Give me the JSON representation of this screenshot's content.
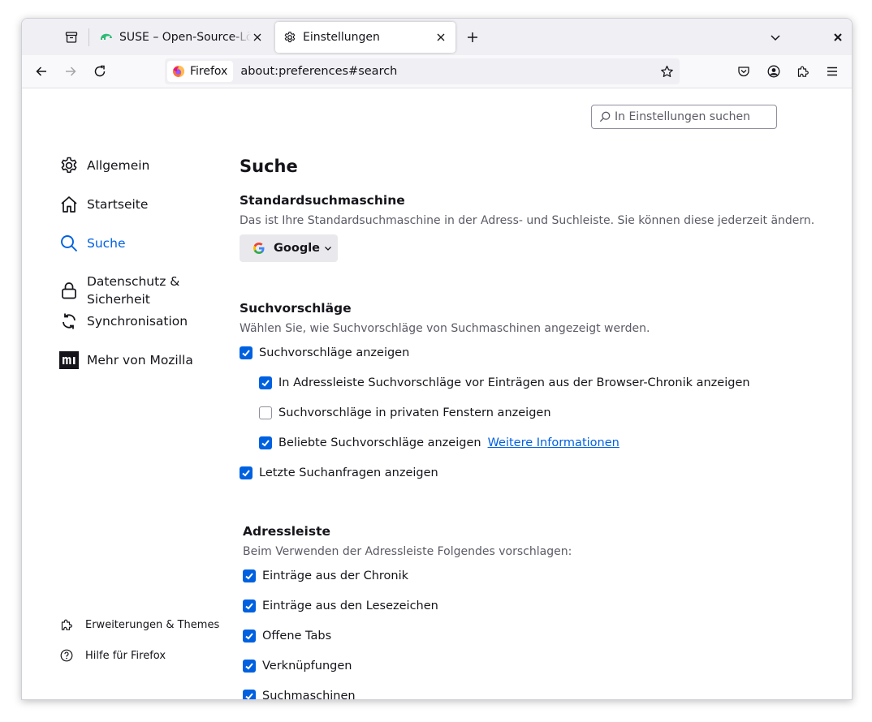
{
  "tabs": [
    {
      "title": "SUSE – Open-Source-Lösungen",
      "active": false,
      "favicon": "suse-chameleon-icon"
    },
    {
      "title": "Einstellungen",
      "active": true,
      "favicon": "gear-icon"
    }
  ],
  "urlbar": {
    "identity_label": "Firefox",
    "url": "about:preferences#search"
  },
  "search_field": {
    "placeholder": "In Einstellungen suchen"
  },
  "sidebar": {
    "items": [
      {
        "label": "Allgemein",
        "icon": "gear-icon"
      },
      {
        "label": "Startseite",
        "icon": "home-icon"
      },
      {
        "label": "Suche",
        "icon": "search-icon",
        "selected": true
      },
      {
        "label": "Datenschutz & Sicherheit",
        "icon": "lock-icon"
      },
      {
        "label": "Synchronisation",
        "icon": "sync-icon"
      },
      {
        "label": "Mehr von Mozilla",
        "icon": "mozilla-icon"
      }
    ],
    "bottom": [
      {
        "label": "Erweiterungen & Themes",
        "icon": "puzzle-icon"
      },
      {
        "label": "Hilfe für Firefox",
        "icon": "help-icon"
      }
    ]
  },
  "main": {
    "title": "Suche",
    "default_engine": {
      "heading": "Standardsuchmaschine",
      "description": "Das ist Ihre Standardsuchmaschine in der Adress- und Suchleiste. Sie können diese jederzeit ändern.",
      "selected": "Google"
    },
    "suggestions": {
      "heading": "Suchvorschläge",
      "description": "Wählen Sie, wie Suchvorschläge von Suchmaschinen angezeigt werden.",
      "options": [
        {
          "label": "Suchvorschläge anzeigen",
          "checked": true
        },
        {
          "label": "In Adressleiste Suchvorschläge vor Einträgen aus der Browser-Chronik anzeigen",
          "checked": true
        },
        {
          "label": "Suchvorschläge in privaten Fenstern anzeigen",
          "checked": false
        },
        {
          "label": "Beliebte Suchvorschläge anzeigen",
          "checked": true,
          "link": "Weitere Informationen"
        },
        {
          "label": "Letzte Suchanfragen anzeigen",
          "checked": true
        }
      ]
    },
    "addressbar": {
      "heading": "Adressleiste",
      "description": "Beim Verwenden der Adressleiste Folgendes vorschlagen:",
      "options": [
        {
          "label": "Einträge aus der Chronik",
          "checked": true
        },
        {
          "label": "Einträge aus den Lesezeichen",
          "checked": true
        },
        {
          "label": "Offene Tabs",
          "checked": true
        },
        {
          "label": "Verknüpfungen",
          "checked": true
        },
        {
          "label": "Suchmaschinen",
          "checked": true
        }
      ]
    }
  },
  "colors": {
    "accent": "#0061e0",
    "text": "#15141a",
    "muted": "#5b5b66"
  }
}
